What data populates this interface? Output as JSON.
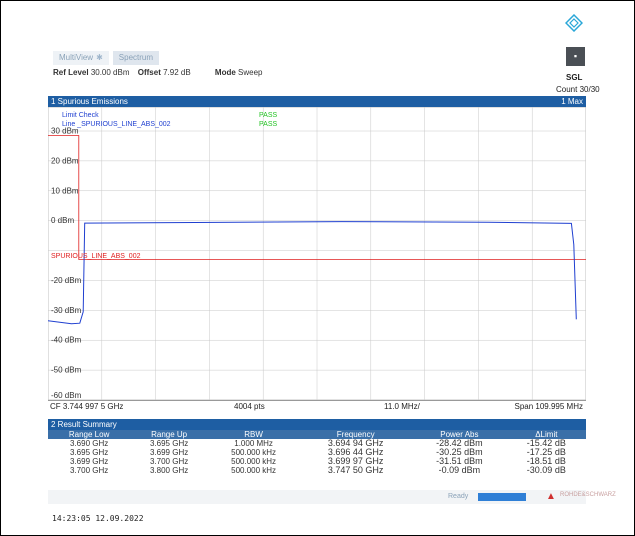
{
  "tabs": [
    {
      "label": "MultiView",
      "active": false,
      "star": "✱"
    },
    {
      "label": "Spectrum",
      "active": true
    }
  ],
  "params": {
    "ref_level_label": "Ref Level",
    "ref_level_value": "30.00 dBm",
    "offset_label": "Offset",
    "offset_value": "7.92 dB",
    "mode_label": "Mode",
    "mode_value": "Sweep"
  },
  "sweep": {
    "sgl": "SGL",
    "count": "Count 30/30"
  },
  "spurious_panel": {
    "title": "1 Spurious Emissions",
    "trace": "1 Max"
  },
  "limit_check": {
    "title": "Limit Check",
    "title_status": "PASS",
    "line": "Line _SPURIOUS_LINE_ABS_002",
    "line_status": "PASS",
    "line_label": "SPURIOUS_LINE_ABS_002"
  },
  "y_ticks": [
    "30 dBm",
    "20 dBm",
    "10 dBm",
    "0 dBm",
    "-20 dBm",
    "-30 dBm",
    "-40 dBm",
    "-50 dBm",
    "-60 dBm"
  ],
  "bottom": {
    "cf": "CF 3.744 997 5 GHz",
    "pts": "4004 pts",
    "div": "11.0 MHz/",
    "span": "Span 109.995 MHz"
  },
  "result_summary": {
    "title": "2 Result Summary",
    "columns": [
      "Range Low",
      "Range Up",
      "RBW",
      "Frequency",
      "Power Abs",
      "ΔLimit"
    ],
    "rows": [
      [
        "3.690 GHz",
        "3.695 GHz",
        "1.000 MHz",
        "3.694 94 GHz",
        "-28.42 dBm",
        "-15.42 dB"
      ],
      [
        "3.695 GHz",
        "3.699 GHz",
        "500.000 kHz",
        "3.696 44 GHz",
        "-30.25 dBm",
        "-17.25 dB"
      ],
      [
        "3.699 GHz",
        "3.700 GHz",
        "500.000 kHz",
        "3.699 97 GHz",
        "-31.51 dBm",
        "-18.51 dB"
      ],
      [
        "3.700 GHz",
        "3.800 GHz",
        "500.000 kHz",
        "3.747 50 GHz",
        "-0.09 dBm",
        "-30.09 dB"
      ]
    ]
  },
  "chart_data": {
    "type": "line",
    "xlabel": "",
    "ylabel": "",
    "ylim": [
      -60,
      30
    ],
    "x_range_ghz": [
      3.69,
      3.79999
    ],
    "grid": true,
    "series": [
      {
        "values_dbm": [
          [
            3.69,
            -33.5
          ],
          [
            3.6948,
            -34.5
          ],
          [
            3.6965,
            -34.3
          ],
          [
            3.6972,
            -30.5
          ],
          [
            3.6975,
            -0.8
          ],
          [
            3.72,
            -0.6
          ],
          [
            3.75,
            -0.3
          ],
          [
            3.78,
            -0.5
          ],
          [
            3.797,
            -0.9
          ],
          [
            3.7975,
            -8
          ],
          [
            3.798,
            -33
          ]
        ]
      }
    ],
    "limit_line": {
      "values_dbm": [
        [
          3.69,
          28.5
        ],
        [
          3.6963,
          28.5
        ],
        [
          3.6963,
          -13
        ],
        [
          3.79999,
          -13
        ]
      ]
    }
  },
  "colors": {
    "panel_header": "#1e5ea3",
    "trace": "#1f3fd0",
    "limit": "#e02020",
    "pass": "#22c322"
  },
  "status": {
    "ready": "Ready"
  },
  "timestamp": "14:23:05  12.09.2022"
}
